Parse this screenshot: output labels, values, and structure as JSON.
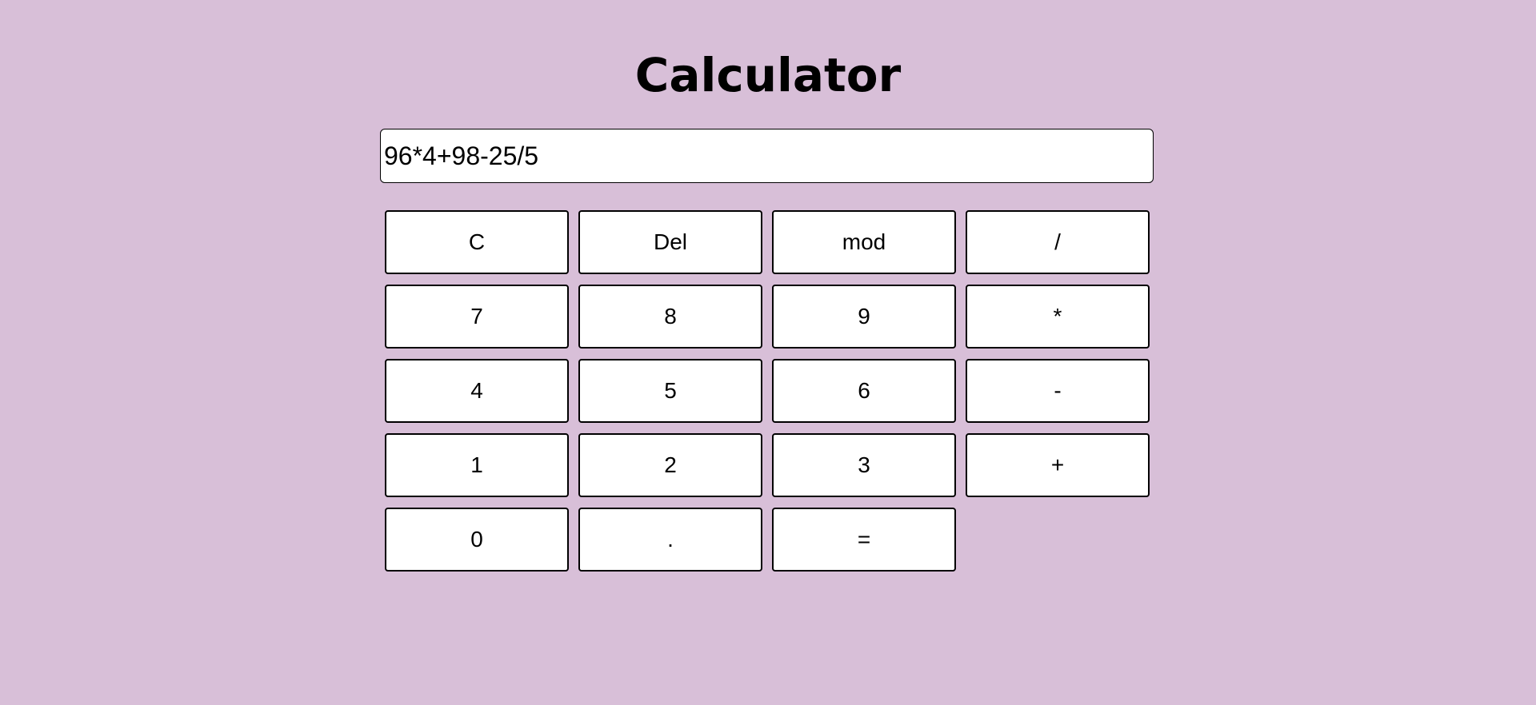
{
  "app": {
    "title": "Calculator"
  },
  "display": {
    "value": "96*4+98-25/5"
  },
  "keys": {
    "clear": "C",
    "delete": "Del",
    "mod": "mod",
    "divide": "/",
    "seven": "7",
    "eight": "8",
    "nine": "9",
    "multiply": "*",
    "four": "4",
    "five": "5",
    "six": "6",
    "minus": "-",
    "one": "1",
    "two": "2",
    "three": "3",
    "plus": "+",
    "zero": "0",
    "decimal": ".",
    "equals": "="
  },
  "colors": {
    "background": "#d8bfd8",
    "button_background": "#ffffff",
    "border": "#000000"
  }
}
